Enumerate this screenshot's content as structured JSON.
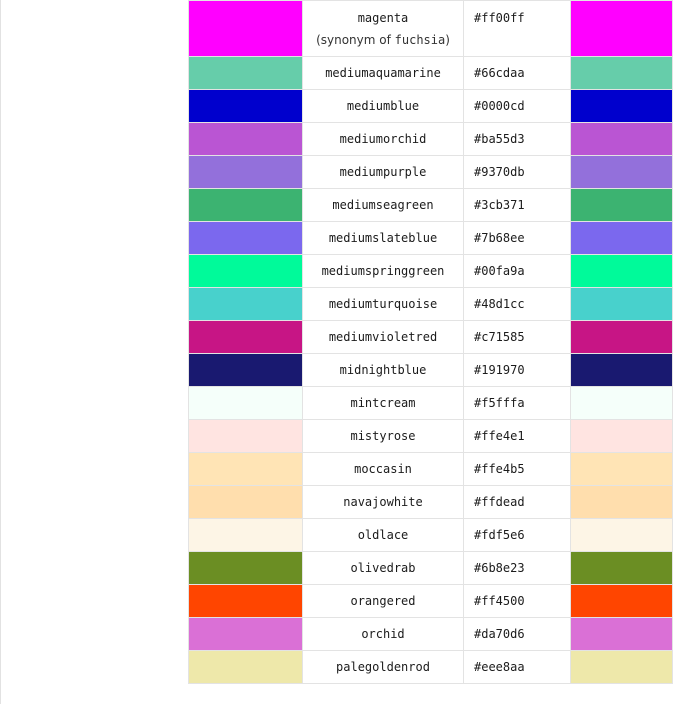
{
  "rows": [
    {
      "name": "magenta",
      "note_prefix": "(synonym of ",
      "note_code": "fuchsia",
      "note_suffix": ")",
      "hex": "#ff00ff",
      "color": "#ff00ff"
    },
    {
      "name": "mediumaquamarine",
      "hex": "#66cdaa",
      "color": "#66cdaa"
    },
    {
      "name": "mediumblue",
      "hex": "#0000cd",
      "color": "#0000cd"
    },
    {
      "name": "mediumorchid",
      "hex": "#ba55d3",
      "color": "#ba55d3"
    },
    {
      "name": "mediumpurple",
      "hex": "#9370db",
      "color": "#9370db"
    },
    {
      "name": "mediumseagreen",
      "hex": "#3cb371",
      "color": "#3cb371"
    },
    {
      "name": "mediumslateblue",
      "hex": "#7b68ee",
      "color": "#7b68ee"
    },
    {
      "name": "mediumspringgreen",
      "hex": "#00fa9a",
      "color": "#00fa9a"
    },
    {
      "name": "mediumturquoise",
      "hex": "#48d1cc",
      "color": "#48d1cc"
    },
    {
      "name": "mediumvioletred",
      "hex": "#c71585",
      "color": "#c71585"
    },
    {
      "name": "midnightblue",
      "hex": "#191970",
      "color": "#191970"
    },
    {
      "name": "mintcream",
      "hex": "#f5fffa",
      "color": "#f5fffa"
    },
    {
      "name": "mistyrose",
      "hex": "#ffe4e1",
      "color": "#ffe4e1"
    },
    {
      "name": "moccasin",
      "hex": "#ffe4b5",
      "color": "#ffe4b5"
    },
    {
      "name": "navajowhite",
      "hex": "#ffdead",
      "color": "#ffdead"
    },
    {
      "name": "oldlace",
      "hex": "#fdf5e6",
      "color": "#fdf5e6"
    },
    {
      "name": "olivedrab",
      "hex": "#6b8e23",
      "color": "#6b8e23"
    },
    {
      "name": "orangered",
      "hex": "#ff4500",
      "color": "#ff4500"
    },
    {
      "name": "orchid",
      "hex": "#da70d6",
      "color": "#da70d6"
    },
    {
      "name": "palegoldenrod",
      "hex": "#eee8aa",
      "color": "#eee8aa"
    }
  ]
}
